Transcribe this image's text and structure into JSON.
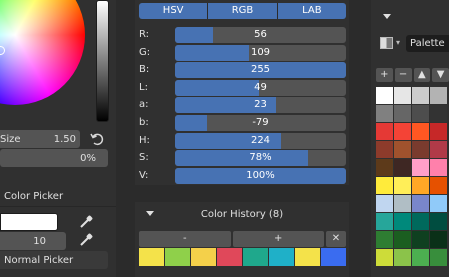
{
  "left_panel": {
    "size_label": "Size",
    "size_value": "1.50",
    "percent_value": "0%",
    "picker_title": "Color Picker",
    "picker_number": "10",
    "normal_picker_label": "Normal Picker"
  },
  "mode_tabs": [
    "HSV",
    "RGB",
    "LAB"
  ],
  "sliders": [
    {
      "label": "R:",
      "value": "56",
      "fill": 0.22
    },
    {
      "label": "G:",
      "value": "109",
      "fill": 0.43
    },
    {
      "label": "B:",
      "value": "255",
      "fill": 1.0
    },
    {
      "label": "L:",
      "value": "49",
      "fill": 0.49
    },
    {
      "label": "a:",
      "value": "23",
      "fill": 0.59
    },
    {
      "label": "b:",
      "value": "-79",
      "fill": 0.19
    },
    {
      "label": "H:",
      "value": "224",
      "fill": 0.62
    },
    {
      "label": "S:",
      "value": "78%",
      "fill": 0.78
    },
    {
      "label": "V:",
      "value": "100%",
      "fill": 1.0
    }
  ],
  "history": {
    "title": "Color History (8)",
    "minus": "-",
    "plus": "+",
    "close": "✕",
    "swatches": [
      "#f4e24a",
      "#8fd04a",
      "#f4d04a",
      "#e0485a",
      "#1fa88c",
      "#1fb0c8",
      "#f4e24a",
      "#3a6cf0"
    ]
  },
  "palette": {
    "label": "Palette",
    "tools": [
      "+",
      "−",
      "▲",
      "▼"
    ],
    "colors": [
      "#ffffff",
      "#e6e6e6",
      "#cccccc",
      "#b3b3b3",
      "#808080",
      "#666666",
      "#4d4d4d",
      "#333333",
      "#e53935",
      "#f44336",
      "#ff5722",
      "#c62828",
      "#8d3b2b",
      "#a0522d",
      "#7a3b2e",
      "#b03a48",
      "#5d3a1a",
      "#3e2723",
      "#ff9fc8",
      "#ff80ab",
      "#ffeb3b",
      "#ffee58",
      "#ffa726",
      "#e65100",
      "#c0d6f0",
      "#b0bec5",
      "#7986cb",
      "#90caf9",
      "#26a69a",
      "#00897b",
      "#00695c",
      "#004d40",
      "#2e7d32",
      "#1b5e20",
      "#0f4020",
      "#0a3018",
      "#cddc39",
      "#8bc34a",
      "#4caf50",
      "#388e3c"
    ]
  }
}
